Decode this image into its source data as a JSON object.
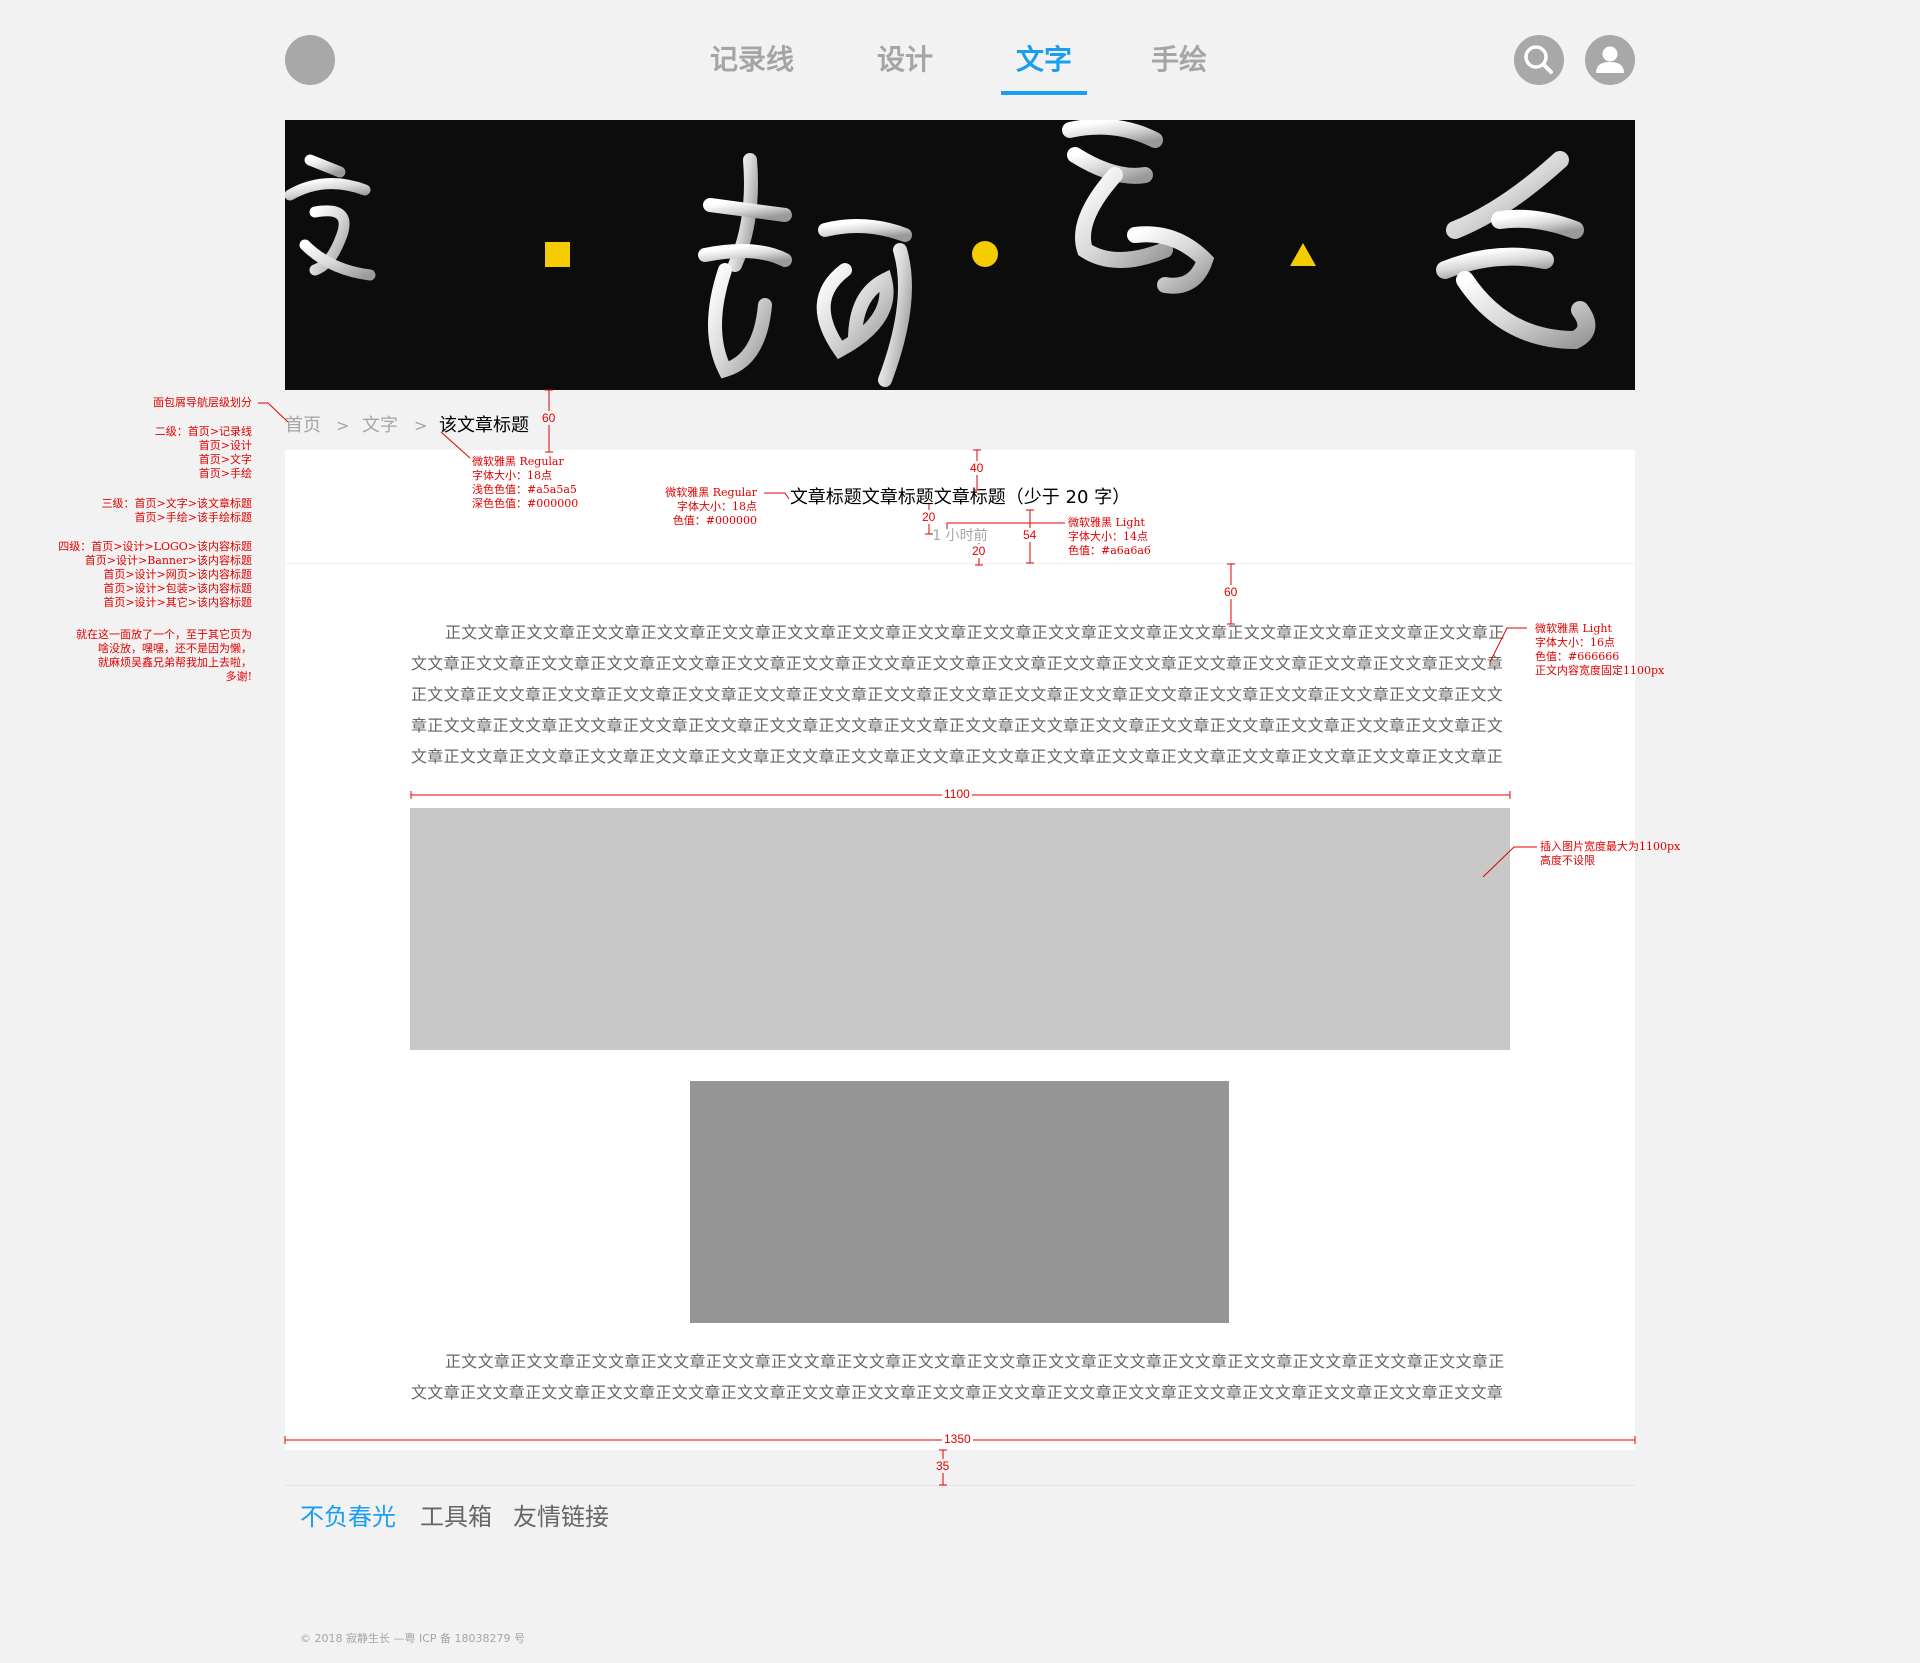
{
  "nav": {
    "items": [
      "记录线",
      "设计",
      "文字",
      "手绘"
    ],
    "active": "文字",
    "accent_color": "#1a9ef0",
    "search_icon": "search-icon",
    "user_icon": "user-icon"
  },
  "banner": {
    "chars": [
      "字",
      "静",
      "生",
      "长"
    ]
  },
  "breadcrumb": {
    "items": [
      "首页",
      "文字",
      "该文章标题"
    ],
    "separator": ">"
  },
  "article": {
    "title": "文章标题文章标题文章标题（少于 20 字）",
    "time": "1 小时前",
    "paragraph1": "正文文章正文文章正文文章正文文章正文文章正文文章正文文章正文文章正文文章正文文章正文文章正文文章正文文章正文文章正文文章正文文章正文文章正文文章正文文章正文文章正文文章正文文章正文文章正文文章正文文章正文文章正文文章正文文章正文文章正文文章正文文章正文文章正文文章正文文章正文文章正文文章正文文章正文文章正文文章正文文章正文文章正文文章正文文章正文文章正文文章正文文章正文文章正文文章正文文章正文文章正文文章正文文章正文文章正文文章正文文章正文文章正文文章正文文章正文文章正文文章正文文章正文文章正文文章正文文章正文文章正文文章正文文章正文文章正文文章正文文章正文文章正文文章正文文章正文文章正文文章正文文章正文文章正文文章正文文章正文文章正文文章正文文章正文文章正文文章正文文章正文文章正文文章正文文章正文文章正文文章正文文章正文文章正文文章正文文章正文文章正文文章正文文章正文文章正文文章正文文章正文文章正文文章正文文章正文文章正文文章正文文章正文文章正文文",
    "paragraph2": "正文文章正文文章正文文章正文文章正文文章正文文章正文文章正文文章正文文章正文文章正文文章正文文章正文文章正文文章正文文章正文文章正文文章正文文章正文文章正文文章正文文章正文文章正文文章正文文章正文文章正文文章正文文章正文文章正文文章正文文章正文文章正文文章正文文章正文文章正文文章正文文章正文文。"
  },
  "footer": {
    "links": [
      "不负春光",
      "工具箱",
      "友情链接"
    ],
    "active": "不负春光",
    "copyright": "© 2018 寂静生长 —粤 ICP 备 18038279 号"
  },
  "annotations": {
    "breadcrumb_title": "面包屑导航层级划分",
    "level2": [
      "二级：首页>记录线",
      "首页>设计",
      "首页>文字",
      "首页>手绘"
    ],
    "level3": [
      "三级：首页>文字>该文章标题",
      "首页>手绘>该手绘标题"
    ],
    "level4": [
      "四级：首页>设计>LOGO>该内容标题",
      "首页>设计>Banner>该内容标题",
      "首页>设计>网页>该内容标题",
      "首页>设计>包装>该内容标题",
      "首页>设计>其它>该内容标题"
    ],
    "note": [
      "就在这一面放了一个，至于其它页为",
      "啥没放，嘿嘿，还不是因为懒，",
      "就麻烦吴鑫兄弟帮我加上去啦，",
      "多谢!"
    ],
    "breadcrumb_font": [
      "微软雅黑 Regular",
      "字体大小：18点",
      "浅色色值：#a5a5a5",
      "深色色值：#000000"
    ],
    "title_font": [
      "微软雅黑 Regular",
      "字体大小：18点",
      "色值：#000000"
    ],
    "time_font": [
      "微软雅黑 Light",
      "字体大小：14点",
      "色值：#a6a6a6"
    ],
    "body_font": [
      "微软雅黑 Light",
      "字体大小：16点",
      "色值：#666666",
      "正文内容宽度固定1100px"
    ],
    "image_note": [
      "插入图片宽度最大为1100px",
      "高度不设限"
    ],
    "dims": {
      "crumb_gap": "60",
      "title_top": "40",
      "title_time_gap": "20",
      "time_bottom": "20",
      "header_height": "54",
      "body_top": "60",
      "content_width": "1100",
      "card_width": "1350",
      "footer_gap": "35"
    }
  }
}
